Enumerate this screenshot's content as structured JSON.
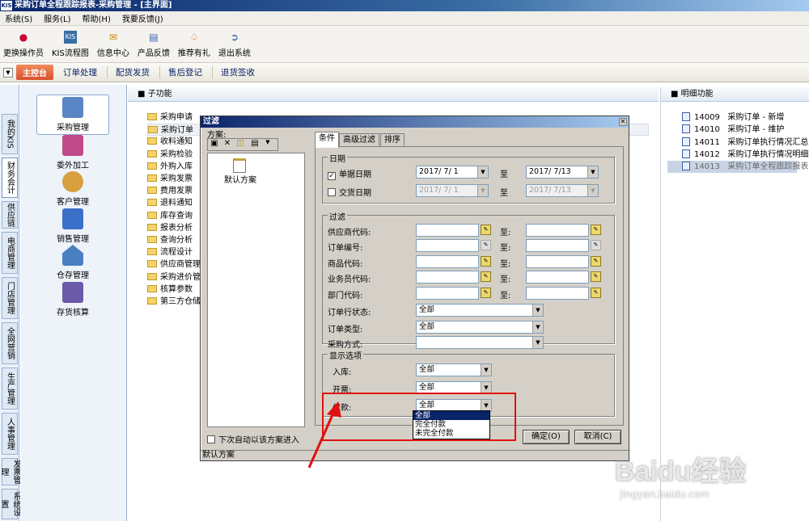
{
  "app": {
    "title": "采购订单全程跟踪报表-采购管理 - [主界面]",
    "logo": "KIS"
  },
  "menu": [
    "系统(S)",
    "服务(L)",
    "帮助(H)",
    "我要反馈(J)"
  ],
  "toolbar": [
    {
      "label": "更换操作员",
      "icon": "users-icon"
    },
    {
      "label": "KIS流程图",
      "icon": "flowchart-icon"
    },
    {
      "label": "信息中心",
      "icon": "message-icon"
    },
    {
      "label": "产品反馈",
      "icon": "feedback-icon"
    },
    {
      "label": "推荐有礼",
      "icon": "gift-icon"
    },
    {
      "label": "退出系统",
      "icon": "exit-icon"
    }
  ],
  "nav": {
    "home": "主控台",
    "items": [
      "订单处理",
      "配货发货",
      "售后登记",
      "退货签收"
    ]
  },
  "vtabs": [
    "我的KIS",
    "财务会计",
    "供应链",
    "电商管理",
    "门店管理",
    "全网营销",
    "生产管理",
    "人事管理",
    "发票管理",
    "系统设置"
  ],
  "modules": [
    "采购管理",
    "委外加工",
    "客户管理",
    "销售管理",
    "仓存管理",
    "存货核算"
  ],
  "panels": {
    "sub_title": "子功能",
    "detail_title": "明细功能"
  },
  "subfunctions": [
    "采购申请",
    "采购订单",
    "收料通知",
    "采购检验",
    "外购入库",
    "采购发票",
    "费用发票",
    "退料通知",
    "库存查询",
    "报表分析",
    "查询分析",
    "流程设计",
    "供应商管理",
    "采购进价管",
    "核算参数",
    "第三方仓储"
  ],
  "details": [
    {
      "code": "14009",
      "name": "采购订单 - 新增"
    },
    {
      "code": "14010",
      "name": "采购订单 - 维护"
    },
    {
      "code": "14011",
      "name": "采购订单执行情况汇总表"
    },
    {
      "code": "14012",
      "name": "采购订单执行情况明细表"
    },
    {
      "code": "14013",
      "name": "采购订单全程跟踪报表"
    }
  ],
  "dialog": {
    "title": "过滤",
    "scheme_label": "方案:",
    "scheme_item": "默认方案",
    "auto_enter": "下次自动以该方案进入",
    "status": "默认方案",
    "tabs": [
      "条件",
      "高级过滤",
      "排序"
    ],
    "date_group": "日期",
    "bill_date_label": "单据日期",
    "delivery_date_label": "交货日期",
    "bill_from": "2017/ 7/ 1",
    "bill_to": "2017/ 7/13",
    "del_from": "2017/ 7/ 1",
    "del_to": "2017/ 7/13",
    "to_label": "至",
    "filter_group": "过滤",
    "filter_rows": [
      "供应商代码:",
      "订单编号:",
      "商品代码:",
      "业务员代码:",
      "部门代码:"
    ],
    "to_colon": "至:",
    "line_status_label": "订单行状态:",
    "line_status": "全部",
    "order_type_label": "订单类型:",
    "order_type": "全部",
    "purchase_method_label": "采购方式:",
    "purchase_method": "",
    "display_group": "显示选项",
    "instock_label": "入库:",
    "instock": "全部",
    "invoice_label": "开票:",
    "invoice": "全部",
    "payment_label": "付款:",
    "payment": "全部",
    "payment_options": [
      "全部",
      "完全付款",
      "未完全付款"
    ],
    "ok": "确定(O)",
    "cancel": "取消(C)"
  },
  "watermark": {
    "brand": "Baidu经验",
    "url": "jingyan.baidu.com"
  },
  "colors": {
    "highlight": "#e01010",
    "title_blue": "#0a246a"
  }
}
